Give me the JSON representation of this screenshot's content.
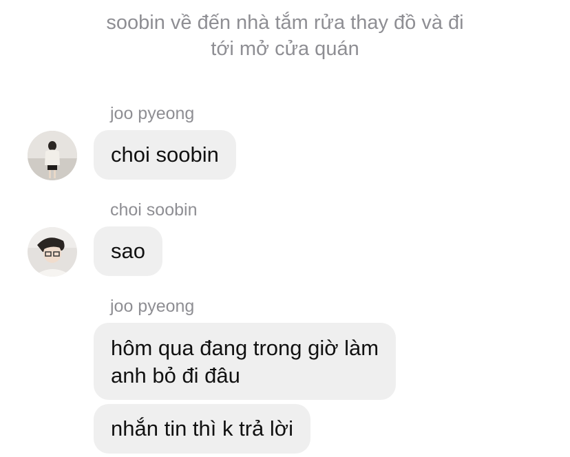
{
  "system_note": {
    "line1": "soobin về đến nhà tắm rửa thay đồ và đi",
    "line2": "tới mở cửa quán"
  },
  "messages": [
    {
      "sender": "joo pyeong",
      "avatar_icon": "girl-profile-photo",
      "bubbles": [
        {
          "text": "choi soobin"
        }
      ]
    },
    {
      "sender": "choi soobin",
      "avatar_icon": "boy-profile-photo",
      "bubbles": [
        {
          "text": "sao"
        }
      ]
    },
    {
      "sender": "joo pyeong",
      "bubbles": [
        {
          "line1": "hôm qua đang trong giờ làm",
          "line2": "anh bỏ đi đâu"
        },
        {
          "text": "nhắn tin thì k trả lời"
        }
      ]
    }
  ],
  "colors": {
    "bubble": "#efefef",
    "meta_text": "#8e8e93",
    "message_text": "#111111"
  }
}
